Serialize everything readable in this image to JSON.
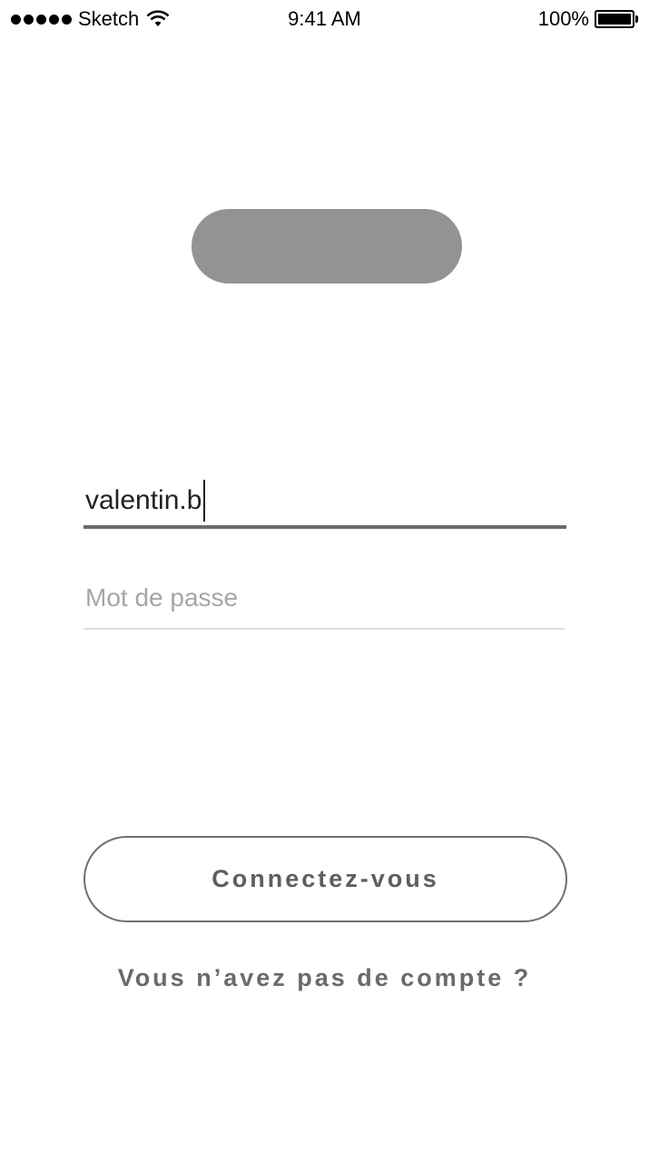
{
  "status_bar": {
    "carrier": "Sketch",
    "time": "9:41 AM",
    "battery": "100%",
    "signal_icon": "signal-dots-icon",
    "wifi_icon": "wifi-icon",
    "battery_icon": "battery-icon"
  },
  "logo": {
    "color": "#939393"
  },
  "login_form": {
    "username_value": "valentin.b",
    "password_placeholder": "Mot de passe",
    "submit_label": "Connectez-vous",
    "signup_link": "Vous n’avez pas de compte ?"
  }
}
